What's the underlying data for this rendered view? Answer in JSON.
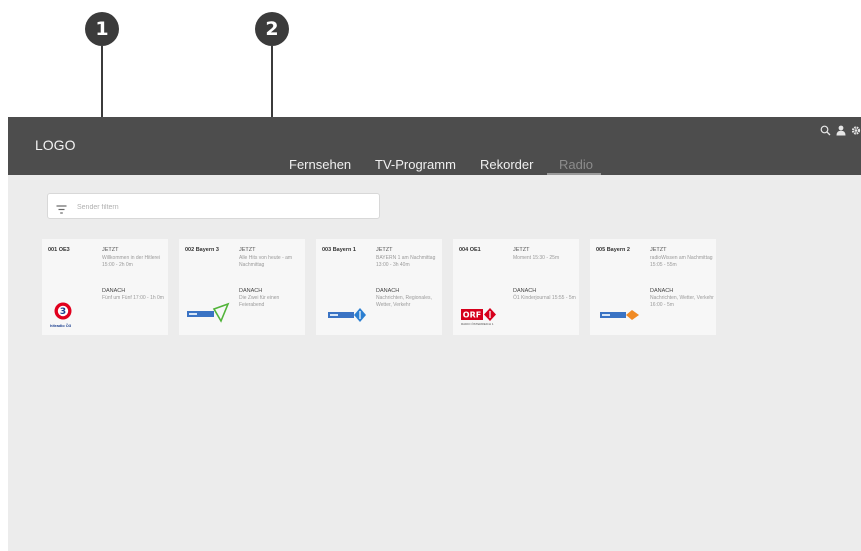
{
  "callouts": [
    "1",
    "2"
  ],
  "header": {
    "logo": "LOGO",
    "nav": [
      "Fernsehen",
      "TV-Programm",
      "Rekorder",
      "Radio"
    ],
    "active_nav": "Radio",
    "icons": [
      "search-icon",
      "user-icon",
      "settings-icon"
    ]
  },
  "search": {
    "placeholder": "Sender filtern",
    "value": "",
    "icon": "filter-icon"
  },
  "channels": [
    {
      "name": "001 OE3",
      "now_label": "JETZT",
      "now_text": "Willkommen in der Hitlerei 15:00 - 2h 0m",
      "next_label": "DANACH",
      "next_text": "Fünf um Fünf 17:00 - 1h 0m",
      "logo_caption": "hitradio Ö3"
    },
    {
      "name": "002 Bayern 3",
      "now_label": "JETZT",
      "now_text": "Alle Hits von heute - am Nachmittag",
      "next_label": "DANACH",
      "next_text": "Die Zwei für einen Feierabend",
      "logo_caption": ""
    },
    {
      "name": "003 Bayern 1",
      "now_label": "JETZT",
      "now_text": "BAYERN 1 am Nachmittag 13:00 - 3h 40m",
      "next_label": "DANACH",
      "next_text": "Nachrichten, Regionales, Wetter, Verkehr",
      "logo_caption": ""
    },
    {
      "name": "004 OE1",
      "now_label": "JETZT",
      "now_text": "Moment 15:30 - 25m",
      "next_label": "DANACH",
      "next_text": "Ö1 Kinderjournal 15:55 - 5m",
      "logo_caption": "RADIO ÖSTERREICH 1"
    },
    {
      "name": "005 Bayern 2",
      "now_label": "JETZT",
      "now_text": "radioWissen am Nachmittag 15:05 - 55m",
      "next_label": "DANACH",
      "next_text": "Nachrichten, Wetter, Verkehr 16:00 - 5m",
      "logo_caption": ""
    }
  ],
  "colors": {
    "topbar": "#4d4d4d",
    "content_bg": "#ececec",
    "oe3_red": "#e1001e",
    "oe3_blue": "#1b3f8f",
    "orf_red": "#d6001c",
    "br_blue": "#3a73c4",
    "bayern3_green": "#52b43a",
    "bayern1_blue": "#2c7fd1",
    "bayern2_orange": "#f08a24"
  }
}
